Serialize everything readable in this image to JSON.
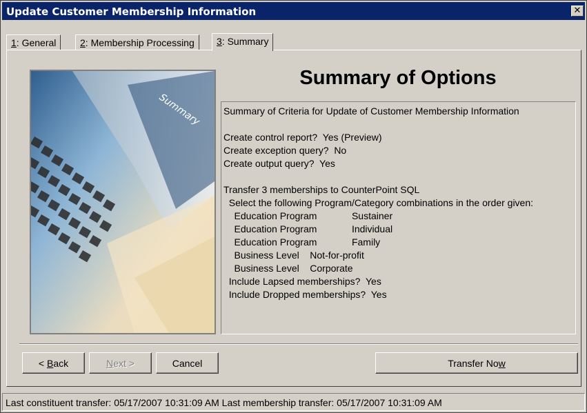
{
  "window": {
    "title": "Update Customer Membership Information",
    "close_glyph": "✕"
  },
  "tabs": [
    {
      "num": "1",
      "label": ": General"
    },
    {
      "num": "2",
      "label": ": Membership Processing"
    },
    {
      "num": "3",
      "label": ": Summary"
    }
  ],
  "active_tab": 2,
  "main": {
    "heading": "Summary of Options",
    "image_label": "Summary",
    "summary_lines": [
      "Summary of Criteria for Update of Customer Membership Information",
      "",
      "Create control report?  Yes (Preview)",
      "Create exception query?  No",
      "Create output query?  Yes",
      "",
      "Transfer 3 memberships to CounterPoint SQL",
      "  Select the following Program/Category combinations in the order given:",
      "    Education Program             Sustainer",
      "    Education Program             Individual",
      "    Education Program             Family",
      "    Business Level    Not-for-profit",
      "    Business Level    Corporate",
      "  Include Lapsed memberships?  Yes",
      "  Include Dropped memberships?  Yes"
    ]
  },
  "buttons": {
    "back_accel": "B",
    "back_rest": "ack",
    "back_prefix": "< ",
    "next_accel": "N",
    "next_rest": "ext >",
    "cancel": "Cancel",
    "transfer_prefix": "Transfer No",
    "transfer_accel": "w"
  },
  "status": {
    "text": "Last constituent transfer: 05/17/2007 10:31:09 AM   Last membership transfer: 05/17/2007 10:31:09 AM"
  }
}
